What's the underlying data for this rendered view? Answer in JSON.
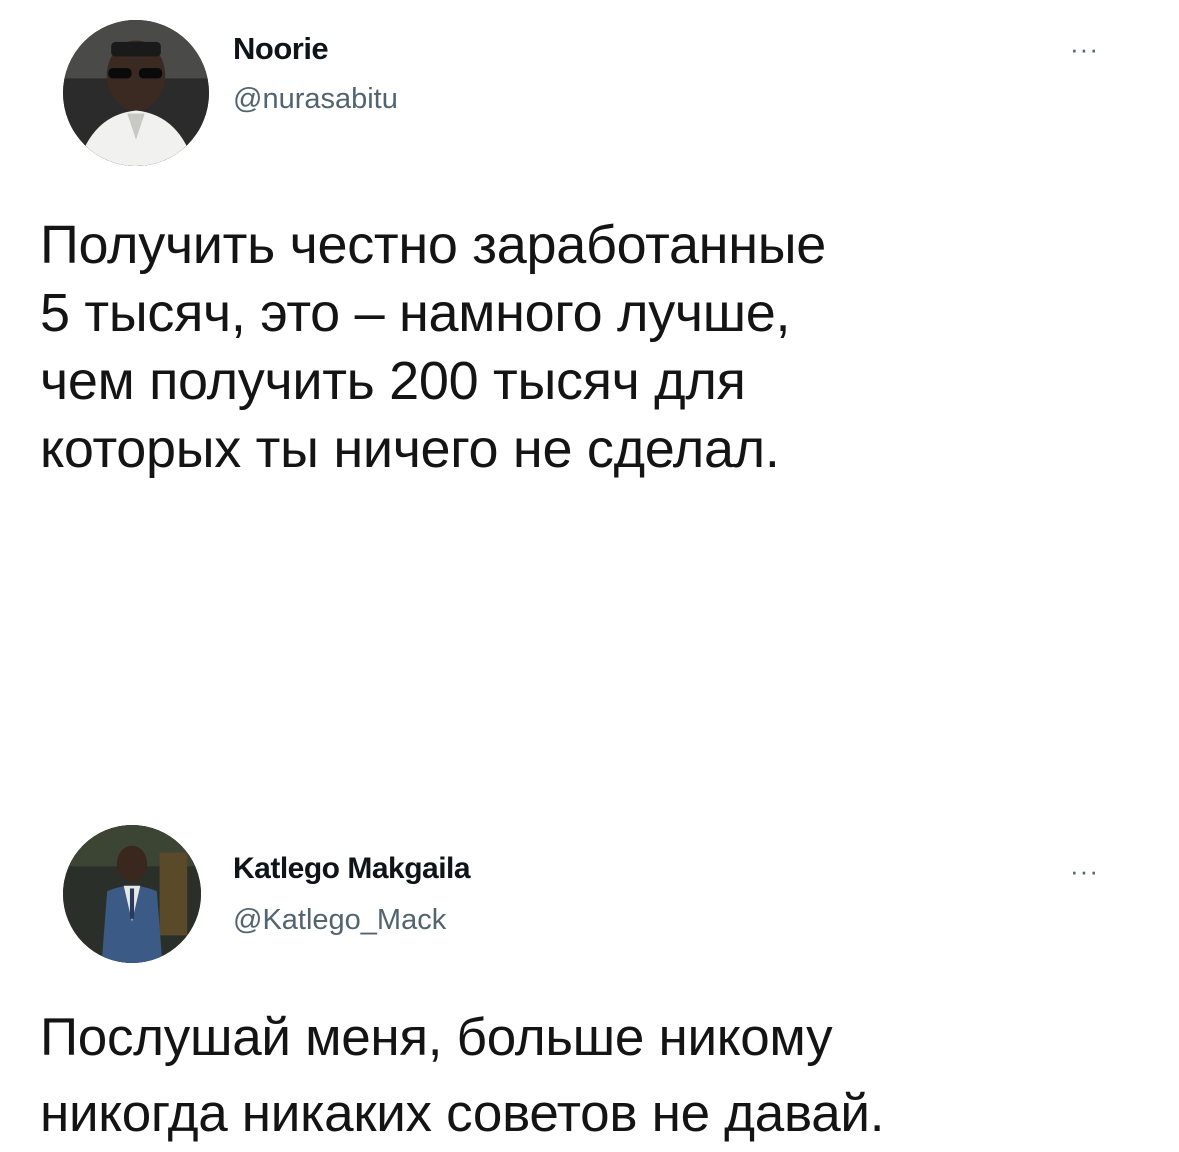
{
  "tweets": [
    {
      "name": "Noorie",
      "handle": "@nurasabitu",
      "more_label": "···",
      "text": "Получить честно заработанные\n5 тысяч, это – намного лучше,\nчем получить 200 тысяч для\nкоторых ты ничего не сделал."
    },
    {
      "name": "Katlego Makgaila",
      "handle": "@Katlego_Mack",
      "more_label": "···",
      "text": "Послушай меня, больше никому\nникогда никаких советов не давай."
    }
  ],
  "icons": {
    "more": "more-options-icon",
    "avatar": "avatar-photo"
  }
}
